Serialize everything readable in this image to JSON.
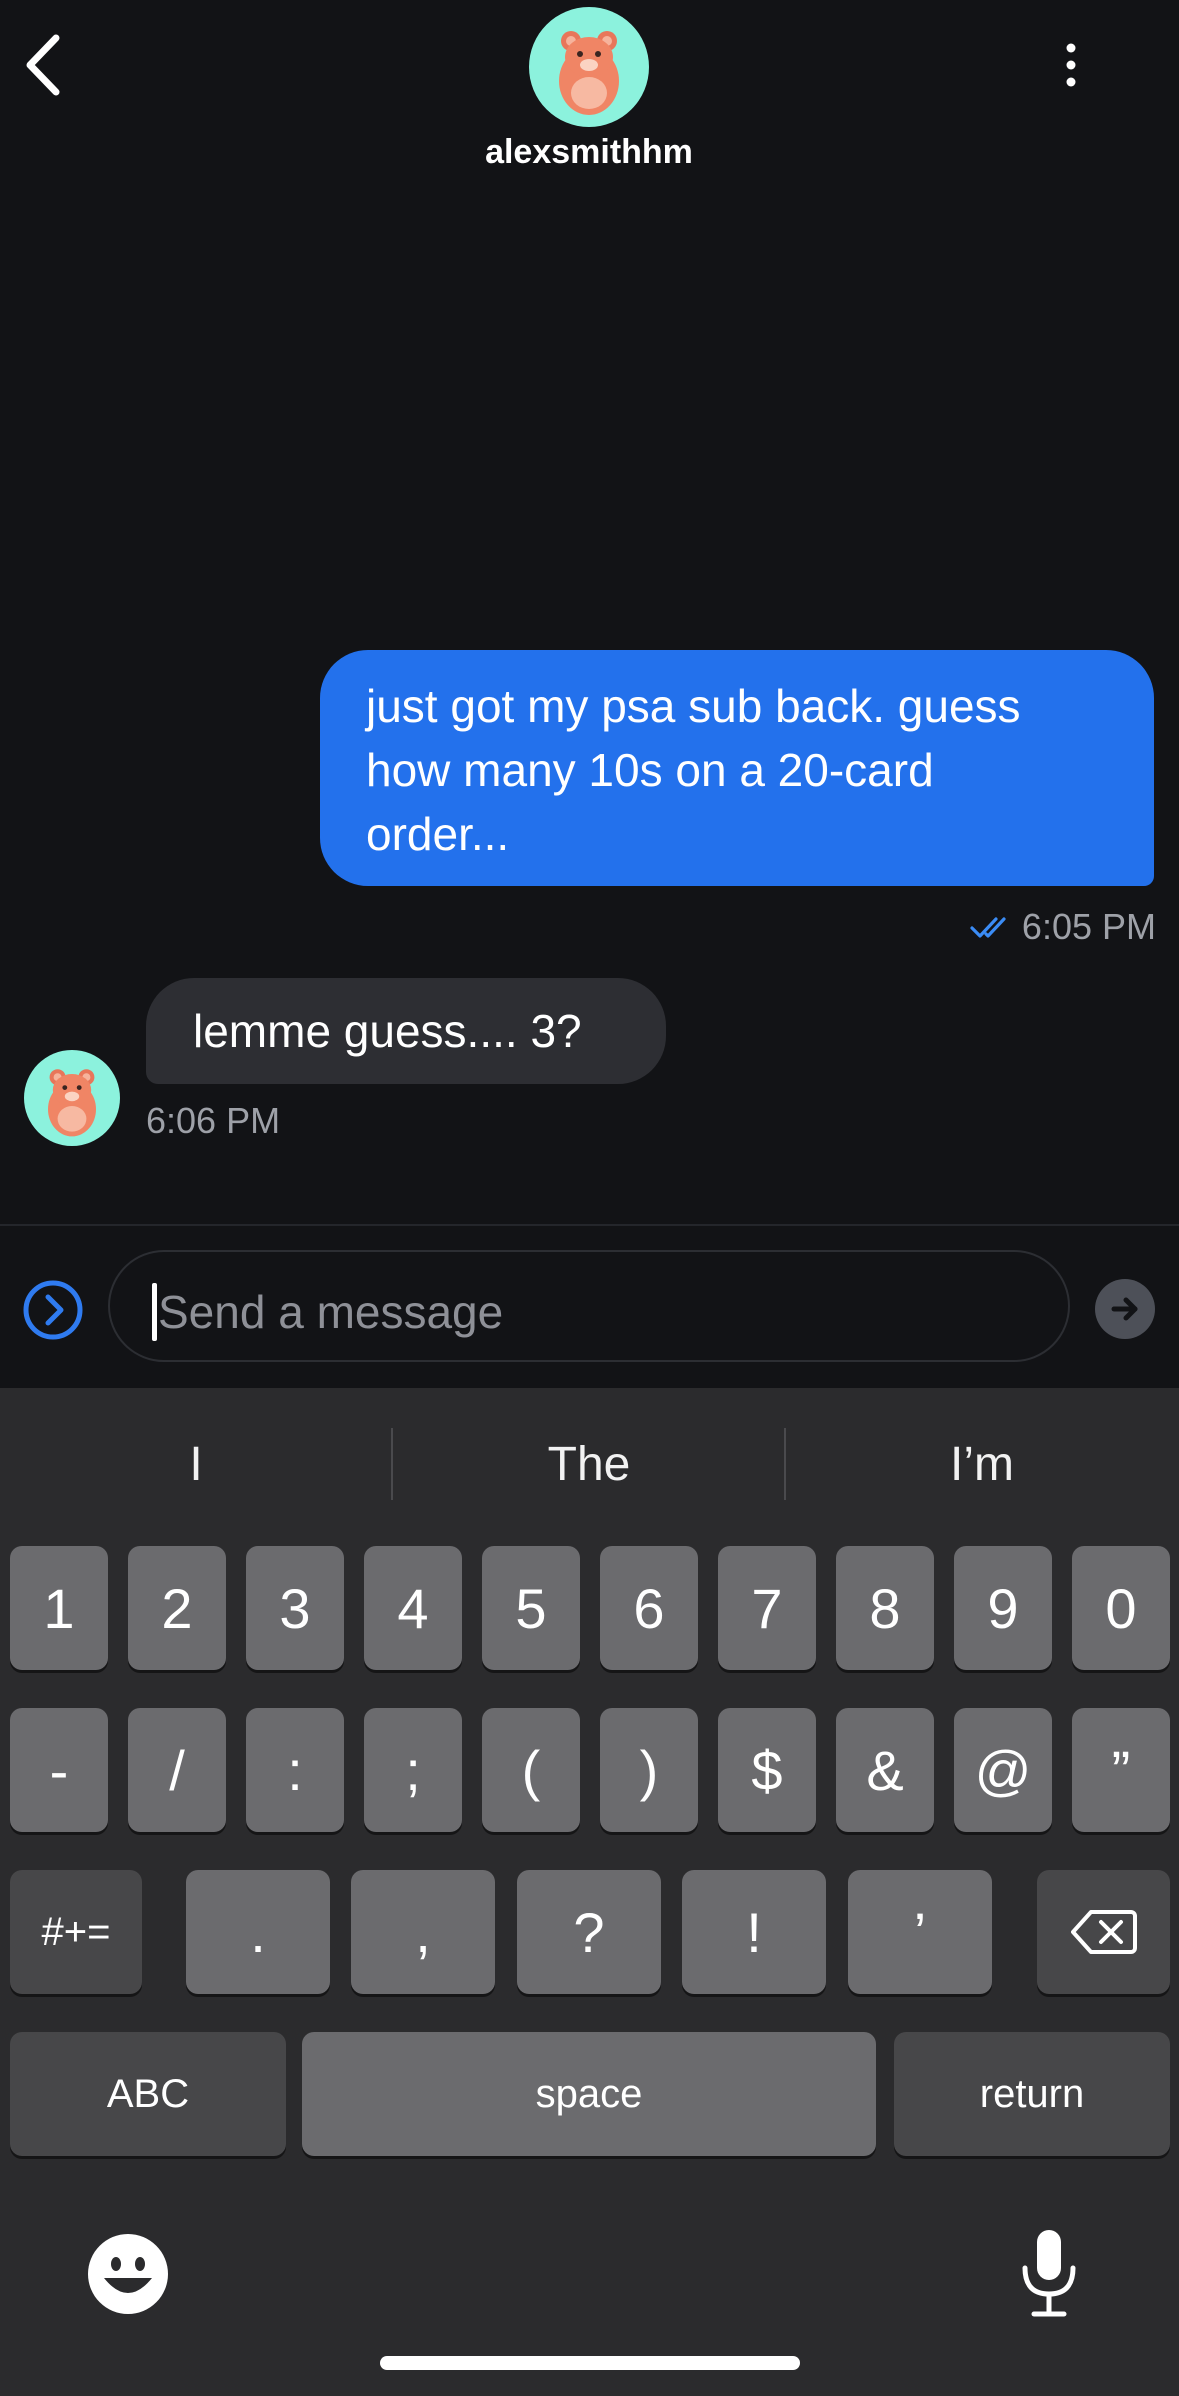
{
  "header": {
    "back_icon": "chevron-left-icon",
    "username": "alexsmithhm",
    "avatar_icon": "bear-avatar",
    "menu_icon": "vertical-dots-icon"
  },
  "messages": [
    {
      "direction": "outgoing",
      "text_lines": [
        "just got my psa sub back. guess",
        "how many 10s on a 20-card",
        "order..."
      ],
      "time": "6:05 PM",
      "status_icon": "double-check-icon"
    },
    {
      "direction": "incoming",
      "text": "lemme guess.... 3?",
      "time": "6:06 PM"
    }
  ],
  "composer": {
    "placeholder": "Send a message",
    "expand_icon": "circle-chevron-right-icon",
    "send_icon": "arrow-right-icon"
  },
  "keyboard": {
    "suggestions": [
      "I",
      "The",
      "I’m"
    ],
    "row1": [
      "1",
      "2",
      "3",
      "4",
      "5",
      "6",
      "7",
      "8",
      "9",
      "0"
    ],
    "row2": [
      "-",
      "/",
      ":",
      ";",
      "(",
      ")",
      "$",
      "&",
      "@",
      "”"
    ],
    "row3": {
      "shift": "#+=",
      "keys": [
        ".",
        ",",
        "?",
        "!",
        "’"
      ],
      "delete_icon": "backspace-icon"
    },
    "row4": {
      "abc": "ABC",
      "space": "space",
      "return": "return"
    },
    "emoji_icon": "emoji-icon",
    "mic_icon": "microphone-icon"
  },
  "colors": {
    "background": "#121316",
    "outgoing_bubble": "#2371ec",
    "incoming_bubble": "#2d2e33",
    "avatar_bg": "#8cf2dd",
    "keyboard_bg": "#2b2b2d"
  }
}
